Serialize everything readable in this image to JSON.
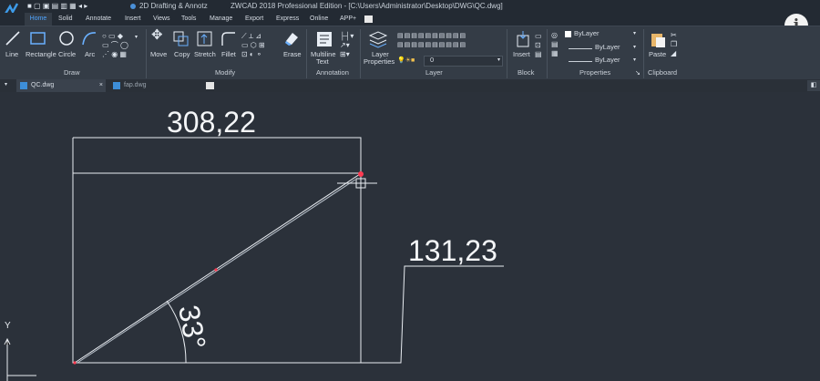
{
  "titlebar": {
    "workspace": "2D Drafting & Annotz",
    "title": "ZWCAD 2018 Professional Edition - [C:\\Users\\Administrator\\Desktop\\DWG\\QC.dwg]"
  },
  "tabs": [
    "Home",
    "Solid",
    "Annotate",
    "Insert",
    "Views",
    "Tools",
    "Manage",
    "Export",
    "Express",
    "Online",
    "APP+"
  ],
  "draw": {
    "line": "Line",
    "rectangle": "Rectangle",
    "circle": "Circle",
    "arc": "Arc",
    "panel": "Draw"
  },
  "modify": {
    "move": "Move",
    "copy": "Copy",
    "stretch": "Stretch",
    "fillet": "Fillet",
    "erase": "Erase",
    "panel": "Modify"
  },
  "annotation": {
    "mtext1": "Multiline",
    "mtext2": "Text",
    "panel": "Annotation"
  },
  "layer": {
    "props1": "Layer",
    "props2": "Properties",
    "current": "0",
    "panel": "Layer"
  },
  "block": {
    "insert": "Insert",
    "panel": "Block"
  },
  "properties": {
    "color": "ByLayer",
    "linetype": "ByLayer",
    "lineweight": "ByLayer",
    "panel": "Properties"
  },
  "clipboard": {
    "paste": "Paste",
    "panel": "Clipboard"
  },
  "documents": [
    "QC.dwg",
    "fap.dwg"
  ],
  "drawing": {
    "width_dim": "308,22",
    "height_dim": "131,23",
    "angle_dim": "33°",
    "ucs_y": "Y"
  }
}
